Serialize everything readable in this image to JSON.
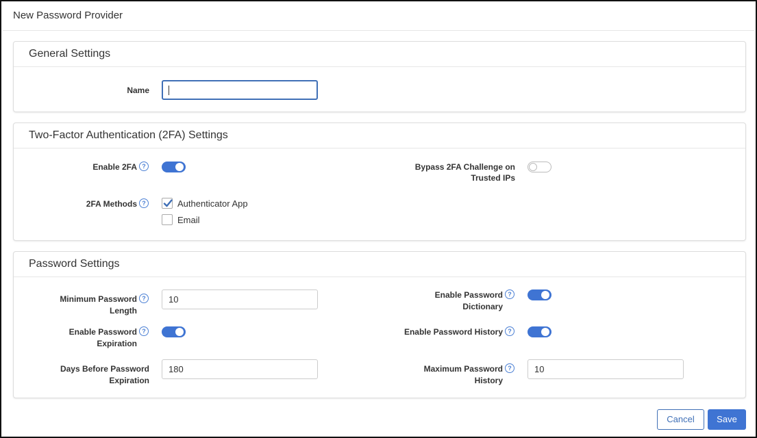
{
  "dialog": {
    "title": "New Password Provider"
  },
  "general": {
    "heading": "General Settings",
    "name_label": "Name",
    "name_value": ""
  },
  "twofa": {
    "heading": "Two-Factor Authentication (2FA) Settings",
    "enable_label": "Enable 2FA",
    "enable_on": true,
    "bypass_label_1": "Bypass 2FA Challenge on",
    "bypass_label_2": "Trusted IPs",
    "bypass_on": false,
    "methods_label": "2FA Methods",
    "methods": [
      {
        "label": "Authenticator App",
        "checked": true
      },
      {
        "label": "Email",
        "checked": false
      }
    ]
  },
  "password": {
    "heading": "Password Settings",
    "min_length_label_1": "Minimum Password",
    "min_length_label_2": "Length",
    "min_length_value": "10",
    "dictionary_label_1": "Enable Password",
    "dictionary_label_2": "Dictionary",
    "dictionary_on": true,
    "expiration_label_1": "Enable Password",
    "expiration_label_2": "Expiration",
    "expiration_on": true,
    "history_label": "Enable Password History",
    "history_on": true,
    "days_label_1": "Days Before Password",
    "days_label_2": "Expiration",
    "days_value": "180",
    "max_history_label_1": "Maximum Password",
    "max_history_label_2": "History",
    "max_history_value": "10"
  },
  "footer": {
    "cancel_label": "Cancel",
    "save_label": "Save"
  },
  "icons": {
    "help": "question-circle-icon",
    "check": "checkmark-icon"
  },
  "colors": {
    "accent": "#3f74d3",
    "toggle_off_border": "#bbbbbb"
  }
}
